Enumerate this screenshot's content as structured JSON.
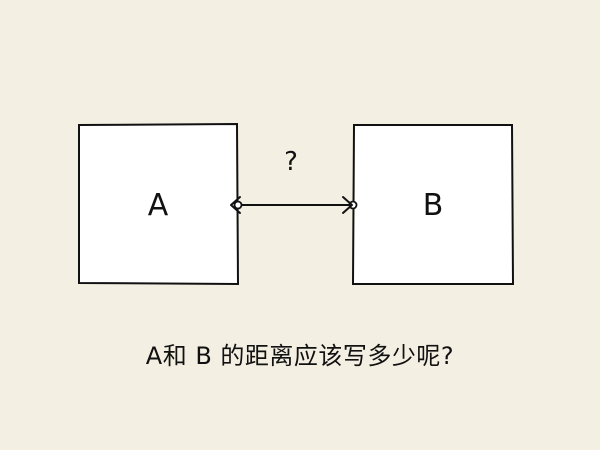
{
  "diagram": {
    "box_a_label": "A",
    "box_b_label": "B",
    "gap_label": "?",
    "caption": "A和 B 的距离应该写多少呢?"
  },
  "colors": {
    "background": "#f4efe3",
    "box_fill": "#ffffff",
    "stroke": "#111111"
  }
}
